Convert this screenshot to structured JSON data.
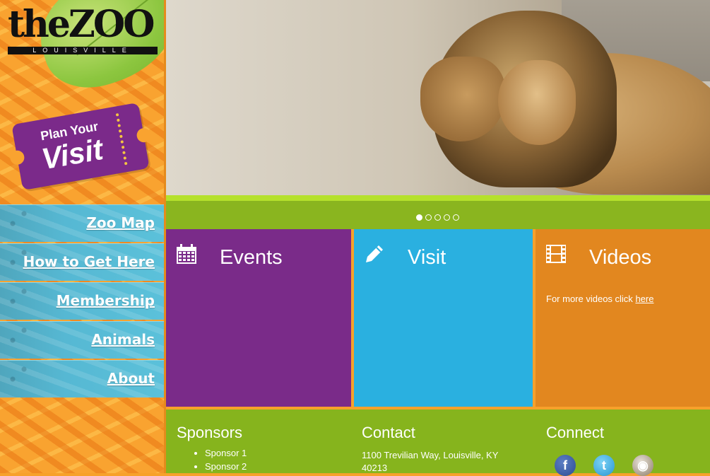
{
  "brand": {
    "logo_main": "theZOO",
    "logo_sub": "LOUISVILLE"
  },
  "plan_visit": {
    "line1": "Plan Your",
    "line2": "Visit"
  },
  "nav": {
    "items": [
      {
        "label": "Zoo Map"
      },
      {
        "label": "How to Get Here"
      },
      {
        "label": "Membership"
      },
      {
        "label": "Animals"
      },
      {
        "label": "About"
      }
    ]
  },
  "slider": {
    "slide_count": 5,
    "active_index": 0
  },
  "tiles": {
    "events": {
      "title": "Events",
      "icon": "calendar-icon",
      "color": "#7a2b89"
    },
    "visit": {
      "title": "Visit",
      "icon": "pencil-icon",
      "color": "#2ab0e0"
    },
    "videos": {
      "title": "Videos",
      "icon": "film-icon",
      "color": "#e2871f",
      "text": "For more videos click",
      "link": "here"
    }
  },
  "footer": {
    "sponsors": {
      "title": "Sponsors",
      "items": [
        "Sponsor 1",
        "Sponsor 2"
      ]
    },
    "contact": {
      "title": "Contact",
      "address": "1100 Trevilian Way, Louisville, KY 40213"
    },
    "connect": {
      "title": "Connect",
      "networks": [
        "facebook-icon",
        "twitter-icon",
        "instagram-icon"
      ]
    }
  },
  "colors": {
    "sidebar_orange": "#f9a330",
    "nav_blue": "#56b8d3",
    "accent_green": "#86b41d"
  }
}
